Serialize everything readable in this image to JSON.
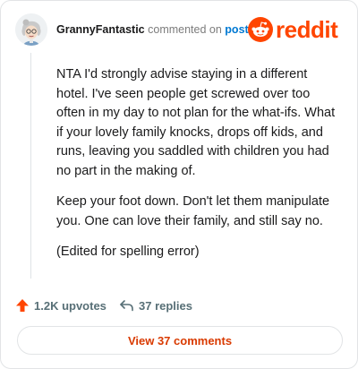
{
  "header": {
    "username": "GrannyFantastic",
    "action": "commented on",
    "target": "post",
    "brand": "reddit"
  },
  "comment": {
    "paragraphs": [
      "NTA I'd strongly advise staying in a different hotel. I've seen people get screwed over too often in my day to not plan for the what-ifs. What if your lovely family knocks, drops off kids, and runs, leaving you saddled with children you had no part in the making of.",
      "Keep your foot down. Don't let them manipulate you. One can love their family, and still say no.",
      "(Edited for spelling error)"
    ]
  },
  "actions": {
    "upvotes": "1.2K upvotes",
    "replies": "37 replies"
  },
  "view_button": {
    "label": "View 37 comments"
  },
  "colors": {
    "brand": "#ff4500",
    "link": "#0079d3",
    "button_text": "#d93a00",
    "muted": "#576f76"
  },
  "icons": {
    "avatar": "granny-avatar",
    "brand": "reddit-snoo-icon",
    "upvote": "upvote-arrow-icon",
    "reply": "reply-arrow-icon"
  }
}
